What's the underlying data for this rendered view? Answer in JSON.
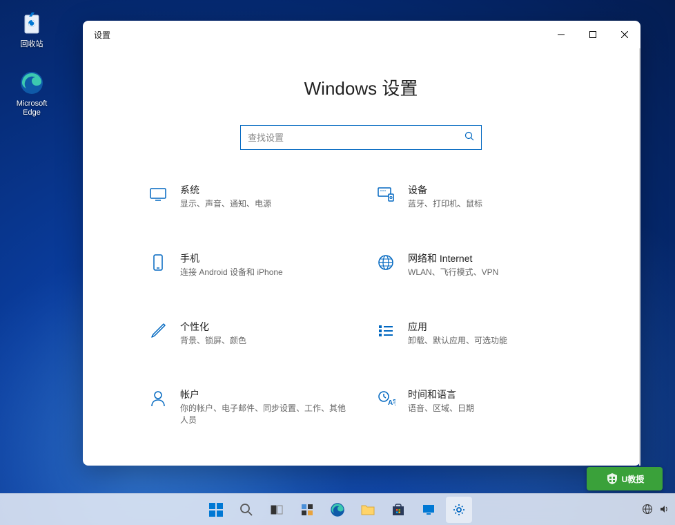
{
  "desktop": {
    "icons": {
      "recycle_bin": "回收站",
      "edge": "Microsoft Edge"
    }
  },
  "window": {
    "title": "设置",
    "heading": "Windows 设置",
    "search_placeholder": "查找设置"
  },
  "categories": [
    {
      "title": "系统",
      "desc": "显示、声音、通知、电源"
    },
    {
      "title": "设备",
      "desc": "蓝牙、打印机、鼠标"
    },
    {
      "title": "手机",
      "desc": "连接 Android 设备和 iPhone"
    },
    {
      "title": "网络和 Internet",
      "desc": "WLAN、飞行模式、VPN"
    },
    {
      "title": "个性化",
      "desc": "背景、锁屏、颜色"
    },
    {
      "title": "应用",
      "desc": "卸载、默认应用、可选功能"
    },
    {
      "title": "帐户",
      "desc": "你的帐户、电子邮件、同步设置、工作、其他人员"
    },
    {
      "title": "时间和语言",
      "desc": "语音、区域、日期"
    }
  ],
  "watermark": "U教授"
}
